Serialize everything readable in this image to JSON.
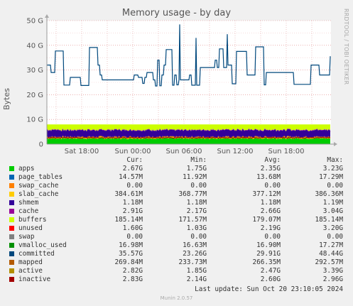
{
  "chart_data": {
    "type": "area",
    "title": "Memory usage - by day",
    "ylabel": "Bytes",
    "ylim": [
      0,
      50
    ],
    "yticks": [
      "0",
      "10 G",
      "20 G",
      "30 G",
      "40 G",
      "50 G"
    ],
    "xticks": [
      "Sat 18:00",
      "Sun 00:00",
      "Sun 06:00",
      "Sun 12:00",
      "Sun 18:00"
    ],
    "grid": true,
    "stacked_layers_G": {
      "apps": 2.35,
      "page_tables": 0.0137,
      "swap_cache": 0.0,
      "slab_cache": 0.377,
      "shmem": 0.0012,
      "cache": 2.66,
      "buffers": 0.179,
      "unused": 2.19
    },
    "committed_series_G": {
      "min": 23.26,
      "max": 48.44,
      "avg": 29.91,
      "cur": 35.57
    }
  },
  "side_credit": "RRDTOOL / TOBI OETIKER",
  "legend": {
    "headers": {
      "cur": "Cur:",
      "min": "Min:",
      "avg": "Avg:",
      "max": "Max:"
    },
    "rows": [
      {
        "name": "apps",
        "color": "#00cc00",
        "cur": "2.67G",
        "min": "1.75G",
        "avg": "2.35G",
        "max": "3.23G"
      },
      {
        "name": "page_tables",
        "color": "#0066b3",
        "cur": "14.57M",
        "min": "11.92M",
        "avg": "13.68M",
        "max": "17.29M"
      },
      {
        "name": "swap_cache",
        "color": "#ff8000",
        "cur": "0.00",
        "min": "0.00",
        "avg": "0.00",
        "max": "0.00"
      },
      {
        "name": "slab_cache",
        "color": "#ffcc00",
        "cur": "384.61M",
        "min": "368.77M",
        "avg": "377.12M",
        "max": "386.36M"
      },
      {
        "name": "shmem",
        "color": "#330099",
        "cur": "1.18M",
        "min": "1.18M",
        "avg": "1.18M",
        "max": "1.19M"
      },
      {
        "name": "cache",
        "color": "#990099",
        "cur": "2.91G",
        "min": "2.17G",
        "avg": "2.66G",
        "max": "3.04G"
      },
      {
        "name": "buffers",
        "color": "#ccff00",
        "cur": "185.14M",
        "min": "171.57M",
        "avg": "179.07M",
        "max": "185.14M"
      },
      {
        "name": "unused",
        "color": "#ff0000",
        "cur": "1.60G",
        "min": "1.03G",
        "avg": "2.19G",
        "max": "3.20G"
      },
      {
        "name": "swap",
        "color": "#808080",
        "cur": "0.00",
        "min": "0.00",
        "avg": "0.00",
        "max": "0.00"
      },
      {
        "name": "vmalloc_used",
        "color": "#008f00",
        "cur": "16.98M",
        "min": "16.63M",
        "avg": "16.90M",
        "max": "17.27M"
      },
      {
        "name": "committed",
        "color": "#00487d",
        "cur": "35.57G",
        "min": "23.26G",
        "avg": "29.91G",
        "max": "48.44G"
      },
      {
        "name": "mapped",
        "color": "#b35a00",
        "cur": "269.84M",
        "min": "233.73M",
        "avg": "266.35M",
        "max": "292.57M"
      },
      {
        "name": "active",
        "color": "#b38f00",
        "cur": "2.82G",
        "min": "1.85G",
        "avg": "2.47G",
        "max": "3.39G"
      },
      {
        "name": "inactive",
        "color": "#a30000",
        "cur": "2.83G",
        "min": "2.14G",
        "avg": "2.60G",
        "max": "2.96G"
      }
    ]
  },
  "last_update": "Last update: Sun Oct 20 23:10:05 2024",
  "footer": "Munin 2.0.57"
}
